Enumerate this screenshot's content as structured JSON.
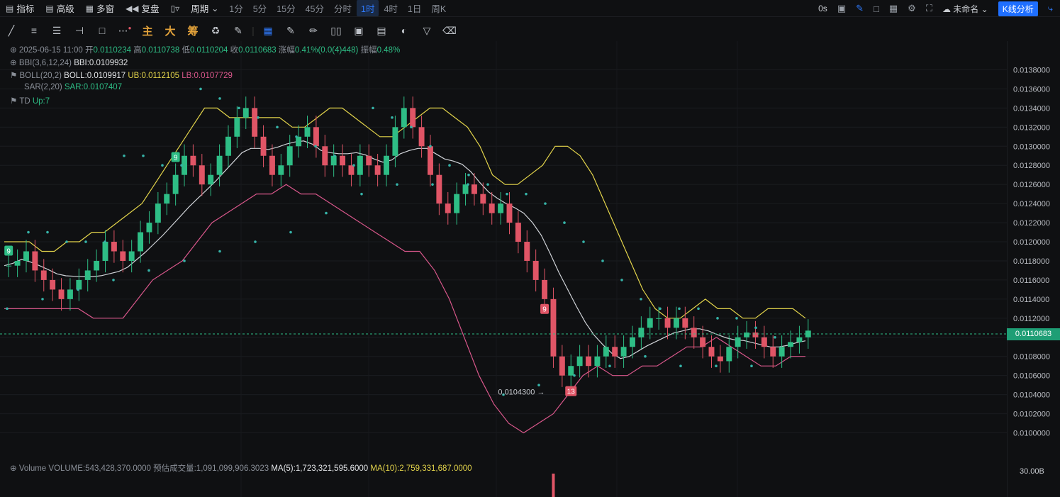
{
  "topbar": {
    "indicators": "指标",
    "advanced": "高级",
    "multi_window": "多窗",
    "replay": "复盘",
    "period": "周期",
    "intervals": [
      "1分",
      "5分",
      "15分",
      "45分",
      "分时",
      "1时",
      "4时",
      "1日",
      "周K"
    ],
    "active_interval": "1时",
    "countdown": "0s",
    "layout_name": "未命名",
    "kline_analysis": "K线分析"
  },
  "toolbar": {
    "main": "主",
    "big": "大",
    "chips": "筹"
  },
  "info": {
    "datetime": "2025-06-15 11:00",
    "open_label": "开",
    "open": "0.0110234",
    "high_label": "高",
    "high": "0.0110738",
    "low_label": "低",
    "low": "0.0110204",
    "close_label": "收",
    "close": "0.0110683",
    "change_label": "涨幅",
    "change": "0.41%(0.0(4)448)",
    "amplitude_label": "振幅",
    "amplitude": "0.48%",
    "bbi_name": "BBI(3,6,12,24)",
    "bbi_value": "BBI:0.0109932",
    "boll_name": "BOLL(20,2)",
    "boll_value": "BOLL:0.0109917",
    "ub_value": "UB:0.0112105",
    "lb_value": "LB:0.0107729",
    "sar_name": "SAR(2,20)",
    "sar_value": "SAR:0.0107407",
    "td_name": "TD",
    "td_value": "Up:7"
  },
  "volume_info": {
    "name": "Volume",
    "volume": "VOLUME:543,428,370.0000",
    "estimated": "预估成交量:1,091,099,906.3023",
    "ma5": "MA(5):1,723,321,595.6000",
    "ma10": "MA(10):2,759,331,687.0000",
    "axis_label": "30.00B"
  },
  "colors": {
    "up": "#2ebd85",
    "down": "#e05566",
    "ub": "#e3d44b",
    "lb": "#d9578b",
    "mid": "#d0d3d8",
    "sar": "#36b3a8",
    "accent": "#2f7bff"
  },
  "chart_data": {
    "type": "candlestick",
    "ylim": [
      0.0099,
      0.0139
    ],
    "y_ticks": [
      "0.0138000",
      "0.0136000",
      "0.0134000",
      "0.0132000",
      "0.0130000",
      "0.0128000",
      "0.0126000",
      "0.0124000",
      "0.0122000",
      "0.0120000",
      "0.0118000",
      "0.0116000",
      "0.0114000",
      "0.0112000",
      "0.0110000",
      "0.0108000",
      "0.0106000",
      "0.0104000",
      "0.0102000",
      "0.0100000"
    ],
    "last_price": "0.0110683",
    "min_annotation": {
      "label": "0.0104300",
      "value": 0.01043,
      "index": 62
    },
    "td_markers": [
      {
        "label": "9",
        "index": 0,
        "value": 0.0119,
        "color": "#2ebd85"
      },
      {
        "label": "9",
        "index": 19,
        "value": 0.01288,
        "color": "#2ebd85"
      },
      {
        "label": "9",
        "index": 61,
        "value": 0.01129,
        "color": "#e05566"
      },
      {
        "label": "13",
        "index": 64,
        "value": 0.01043,
        "color": "#e05566"
      }
    ],
    "closes": [
      0.01175,
      0.0118,
      0.0119,
      0.0117,
      0.0116,
      0.0115,
      0.0114,
      0.0115,
      0.0116,
      0.0117,
      0.0118,
      0.012,
      0.0119,
      0.0118,
      0.0119,
      0.0121,
      0.0122,
      0.0124,
      0.0125,
      0.0127,
      0.0129,
      0.0128,
      0.0126,
      0.0127,
      0.0129,
      0.0131,
      0.0133,
      0.0134,
      0.0131,
      0.0129,
      0.0127,
      0.0128,
      0.013,
      0.0131,
      0.0132,
      0.013,
      0.0128,
      0.0129,
      0.0128,
      0.0127,
      0.0129,
      0.0128,
      0.0127,
      0.0129,
      0.0132,
      0.0134,
      0.0132,
      0.013,
      0.0127,
      0.0124,
      0.0123,
      0.0125,
      0.0126,
      0.0125,
      0.0124,
      0.0123,
      0.0124,
      0.0122,
      0.012,
      0.0118,
      0.0116,
      0.0114,
      0.0108,
      0.0106,
      0.0107,
      0.0108,
      0.0107,
      0.0108,
      0.0109,
      0.0108,
      0.0109,
      0.011,
      0.0111,
      0.0112,
      0.0112,
      0.0111,
      0.0112,
      0.0111,
      0.011,
      0.0109,
      0.0108,
      0.01075,
      0.0109,
      0.011,
      0.01105,
      0.011,
      0.0109,
      0.0108,
      0.0109,
      0.01095,
      0.011,
      0.01107
    ],
    "ub": [
      0.012,
      0.012,
      0.012,
      0.0119,
      0.0119,
      0.012,
      0.012,
      0.0121,
      0.0121,
      0.0122,
      0.0123,
      0.0124,
      0.0126,
      0.0128,
      0.013,
      0.0132,
      0.0134,
      0.0134,
      0.0133,
      0.0133,
      0.0133,
      0.0133,
      0.0133,
      0.0132,
      0.0132,
      0.0133,
      0.0134,
      0.0134,
      0.0133,
      0.0132,
      0.0131,
      0.0131,
      0.0132,
      0.0133,
      0.0134,
      0.0134,
      0.0133,
      0.0132,
      0.013,
      0.0127,
      0.0126,
      0.0126,
      0.0127,
      0.0128,
      0.013,
      0.013,
      0.0129,
      0.0127,
      0.0124,
      0.0121,
      0.0118,
      0.0115,
      0.0113,
      0.0112,
      0.0112,
      0.0113,
      0.0114,
      0.0113,
      0.0113,
      0.0112,
      0.0112,
      0.0113,
      0.0113,
      0.0113,
      0.0112
    ],
    "lb": [
      0.0113,
      0.0113,
      0.0113,
      0.0113,
      0.0113,
      0.0113,
      0.0112,
      0.0112,
      0.0112,
      0.0114,
      0.0116,
      0.0117,
      0.0118,
      0.012,
      0.0122,
      0.0123,
      0.0124,
      0.0125,
      0.0125,
      0.0126,
      0.0125,
      0.0125,
      0.0124,
      0.0123,
      0.0122,
      0.0121,
      0.012,
      0.0119,
      0.0119,
      0.0117,
      0.0114,
      0.011,
      0.0106,
      0.0103,
      0.0101,
      0.01,
      0.0101,
      0.0102,
      0.0104,
      0.0106,
      0.0107,
      0.0106,
      0.0106,
      0.0107,
      0.0107,
      0.0108,
      0.0109,
      0.0109,
      0.011,
      0.0109,
      0.0108,
      0.0107,
      0.0107,
      0.0108,
      0.0108
    ],
    "sar_top": [
      0.0121,
      0.0121,
      0.012,
      0.012,
      0.012,
      0.0129,
      0.0129,
      0.0128,
      0.0128,
      0.0136,
      0.0135,
      0.0134,
      0.0133,
      0.0132,
      0.0131,
      0.013,
      0.0129,
      0.0128,
      0.0134,
      0.0133,
      0.0132,
      0.013,
      0.0128,
      0.0127,
      0.0126,
      0.0125,
      0.0125,
      0.0124,
      0.0122,
      0.012,
      0.0118,
      0.0116,
      0.0114,
      0.0113,
      0.0113,
      0.0113,
      0.0112,
      0.0112,
      0.0111,
      0.011
    ],
    "sar_bottom": [
      0.0113,
      0.0114,
      0.0115,
      0.0116,
      0.0117,
      0.0118,
      0.0119,
      0.012,
      0.0121,
      0.0123,
      0.0125,
      0.0126,
      0.0126,
      0.0126,
      0.0104,
      0.0105,
      0.0106,
      0.0107,
      0.0108,
      0.0107,
      0.0107,
      0.0107
    ]
  }
}
